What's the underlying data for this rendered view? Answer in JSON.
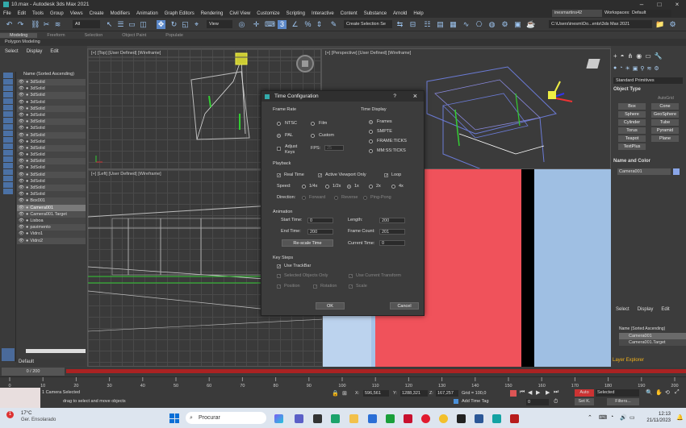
{
  "window": {
    "title": "10.max - Autodesk 3ds Max 2021",
    "user": "inesmartins42",
    "workspaces_label": "Workspaces:",
    "workspace_value": "Default"
  },
  "menu": [
    "File",
    "Edit",
    "Tools",
    "Group",
    "Views",
    "Create",
    "Modifiers",
    "Animation",
    "Graph Editors",
    "Rendering",
    "Civil View",
    "Customize",
    "Scripting",
    "Interactive",
    "Content",
    "Substance",
    "Arnold",
    "Help"
  ],
  "toolbar": {
    "all_filter": "All",
    "view_dropdown": "View",
    "selection_set": "Create Selection Se",
    "path": "C:\\Users\\inesm\\Do...ents\\3ds Max 2021"
  },
  "ribbon": {
    "tabs": [
      "Modeling",
      "Freeform",
      "Selection",
      "Object Paint",
      "Populate"
    ],
    "sub": "Polygon Modeling"
  },
  "scene_explorer": {
    "tabs": [
      "Select",
      "Display",
      "Edit"
    ],
    "header": "Name (Sorted Ascending)",
    "items": [
      "3dSolid",
      "3dSolid",
      "3dSolid",
      "3dSolid",
      "3dSolid",
      "3dSolid",
      "3dSolid",
      "3dSolid",
      "3dSolid",
      "3dSolid",
      "3dSolid",
      "3dSolid",
      "3dSolid",
      "3dSolid",
      "3dSolid",
      "3dSolid",
      "3dSolid",
      "3dSolid",
      "Box001",
      "Camera001",
      "Camera001.Target",
      "Lisboa",
      "pavimento",
      "Vidro1",
      "Vidro2"
    ],
    "layer_label": "Default"
  },
  "viewports": {
    "top": "[+] [Top] [User Defined] [Wireframe]",
    "perspective": "[+] [Perspective] [User Defined] [Wireframe]",
    "left": "[+] [Left] [User Defined] [Wireframe]"
  },
  "command_panel": {
    "dropdown": "Standard Primitives",
    "object_type_title": "Object Type",
    "autogrid": "AutoGrid",
    "buttons": [
      "Box",
      "Cone",
      "Sphere",
      "GeoSphere",
      "Cylinder",
      "Tube",
      "Torus",
      "Pyramid",
      "Teapot",
      "Plane",
      "TextPlus"
    ],
    "name_color_title": "Name and Color",
    "name_value": "Camera001"
  },
  "layer_explorer": {
    "tabs": [
      "Select",
      "Display",
      "Edit"
    ],
    "header": "Name (Sorted Ascending)",
    "items": [
      "Camera001",
      "Camera001.Target"
    ],
    "footer": "Layer Explorer"
  },
  "dialog": {
    "title": "Time Configuration",
    "help": "?",
    "close": "×",
    "frame_rate": {
      "title": "Frame Rate",
      "options": [
        "NTSC",
        "Film",
        "PAL",
        "Custom"
      ],
      "selected": "PAL",
      "adjust_keys": "Adjust Keys",
      "fps_label": "FPS:",
      "fps_value": "25"
    },
    "time_display": {
      "title": "Time Display",
      "options": [
        "Frames",
        "SMPTE",
        "FRAME:TICKS",
        "MM:SS:TICKS"
      ],
      "selected": "Frames"
    },
    "playback": {
      "title": "Playback",
      "real_time": "Real Time",
      "active_viewport": "Active Viewport Only",
      "loop": "Loop",
      "speed_label": "Speed:",
      "speeds": [
        "1/4x",
        "1/2x",
        "1x",
        "2x",
        "4x"
      ],
      "speed_selected": "1x",
      "direction_label": "Direction:",
      "directions": [
        "Forward",
        "Reverse",
        "Ping-Pong"
      ]
    },
    "animation": {
      "title": "Animation",
      "start_label": "Start Time:",
      "start_value": "0",
      "length_label": "Length:",
      "length_value": "200",
      "end_label": "End Time:",
      "end_value": "200",
      "frame_count_label": "Frame Count:",
      "frame_count_value": "201",
      "rescale_button": "Re-scale Time",
      "current_label": "Current Time:",
      "current_value": "0"
    },
    "key_steps": {
      "title": "Key Steps",
      "use_trackbar": "Use TrackBar",
      "selected_only": "Selected Objects Only",
      "use_current": "Use Current Transform",
      "position": "Position",
      "rotation": "Rotation",
      "scale": "Scale"
    },
    "ok": "OK",
    "cancel": "Cancel"
  },
  "timeline": {
    "frame": "0 / 200",
    "ticks": [
      "0",
      "10",
      "20",
      "30",
      "40",
      "50",
      "60",
      "70",
      "80",
      "90",
      "100",
      "110",
      "120",
      "130",
      "140",
      "150",
      "160",
      "170",
      "180",
      "190",
      "200"
    ]
  },
  "status": {
    "message": "1 Camera Selected",
    "hint": "drag to select and move objects",
    "x_label": "X:",
    "x_value": "596,561",
    "y_label": "Y:",
    "y_value": "1288,321",
    "z_label": "Z:",
    "z_value": "167,257",
    "grid": "Grid = 100,0",
    "add_time_tag": "Add Time Tag",
    "auto": "Auto",
    "selected": "Selected",
    "set_k": "Set K.",
    "filters": "Filters...",
    "frame_value": "0"
  },
  "taskbar": {
    "weather_temp": "17°C",
    "weather_desc": "Ger. Ensolarado",
    "search": "Procurar",
    "time": "12:13",
    "date": "21/11/2023"
  }
}
